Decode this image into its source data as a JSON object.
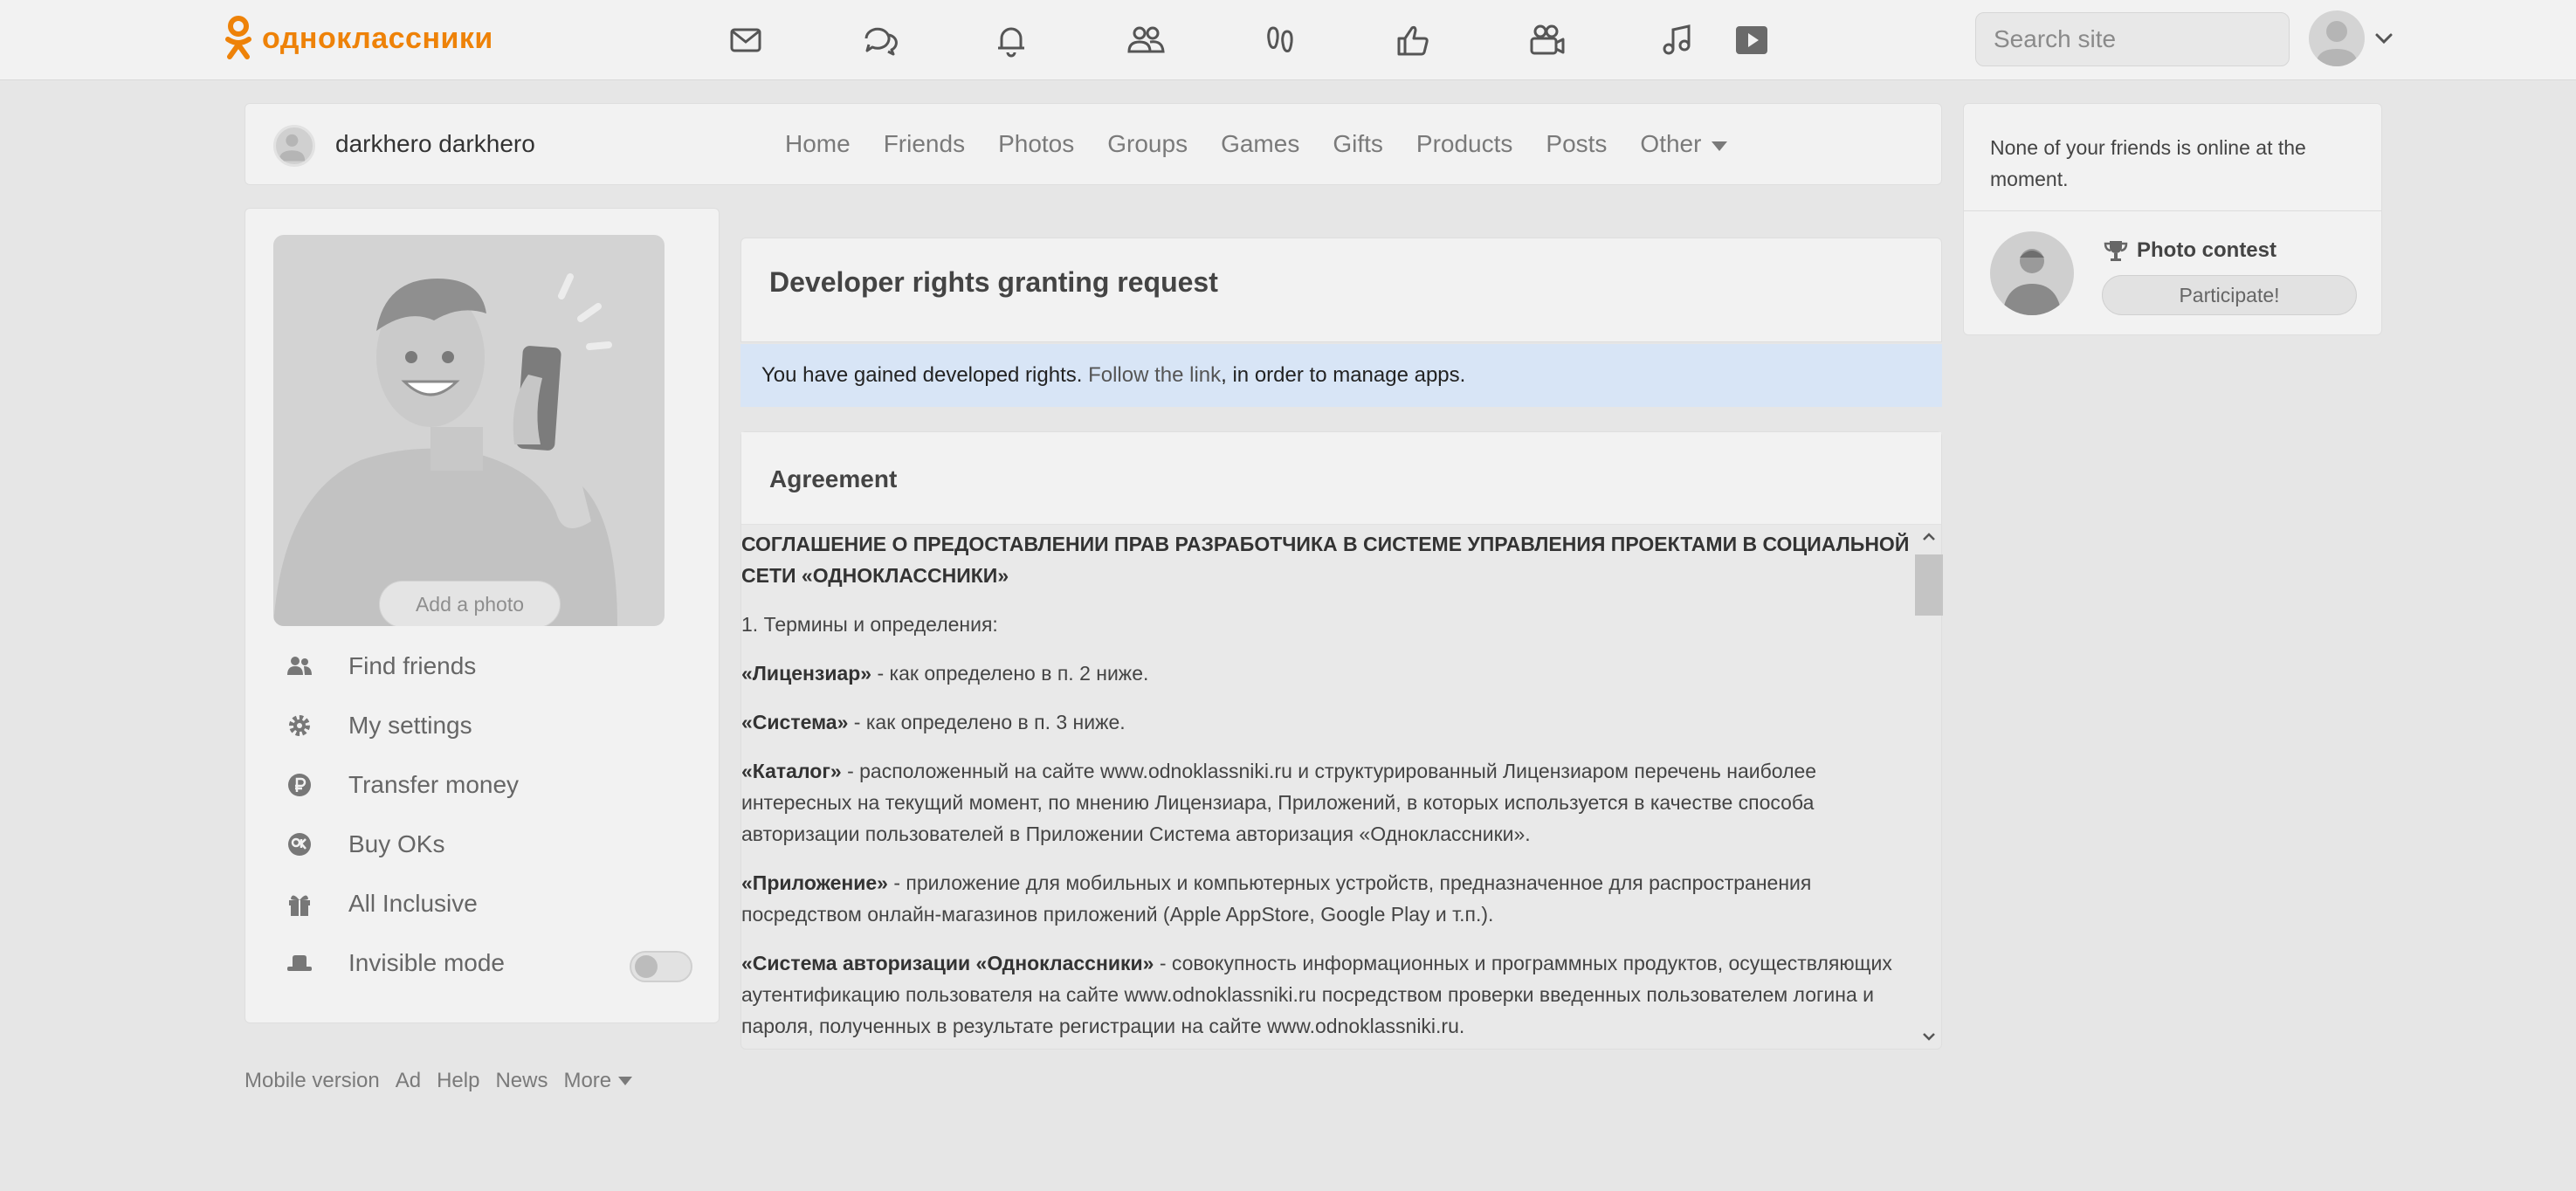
{
  "brand": {
    "name": "одноклассники",
    "color": "#ee8208"
  },
  "topnav": {
    "icons": [
      "envelope-icon",
      "chat-bubbles-icon",
      "bell-icon",
      "people-icon",
      "footprints-icon",
      "thumbs-up-icon",
      "camera-icon",
      "music-note-icon",
      "video-play-icon"
    ],
    "search_placeholder": "Search site"
  },
  "userbar": {
    "username": "darkhero darkhero",
    "nav": [
      "Home",
      "Friends",
      "Photos",
      "Groups",
      "Games",
      "Gifts",
      "Products",
      "Posts"
    ],
    "other_label": "Other"
  },
  "leftmenu": {
    "add_photo": "Add a photo",
    "items": [
      {
        "label": "Find friends",
        "icon": "people-icon"
      },
      {
        "label": "My settings",
        "icon": "gear-icon"
      },
      {
        "label": "Transfer money",
        "icon": "ruble-coin-icon"
      },
      {
        "label": "Buy OKs",
        "icon": "ok-coin-icon"
      },
      {
        "label": "All Inclusive",
        "icon": "gift-icon"
      },
      {
        "label": "Invisible mode",
        "icon": "hat-icon",
        "toggle": false
      }
    ]
  },
  "footer": {
    "links": [
      "Mobile version",
      "Ad",
      "Help",
      "News"
    ],
    "more": "More"
  },
  "main": {
    "title": "Developer rights granting request",
    "notice": {
      "before": "You have gained developed rights. ",
      "link": "Follow the link",
      "after": ", in order to manage apps."
    },
    "agreement": {
      "heading": "Agreement",
      "doc_title": "СОГЛАШЕНИЕ О ПРЕДОСТАВЛЕНИИ ПРАВ РАЗРАБОТЧИКА В СИСТЕМЕ УПРАВЛЕНИЯ ПРОЕКТАМИ В СОЦИАЛЬНОЙ СЕТИ «ОДНОКЛАССНИКИ»",
      "section1": "1. Термины и определения:",
      "defs": [
        {
          "term": "«Лицензиар»",
          "text": " - как определено в п. 2 ниже."
        },
        {
          "term": "«Система»",
          "text": " - как определено в п. 3 ниже."
        },
        {
          "term": "«Каталог»",
          "text": " - расположенный на сайте www.odnoklassniki.ru и структурированный Лицензиаром перечень наиболее интересных на текущий момент, по мнению Лицензиара, Приложений, в которых используется в качестве способа авторизации пользователей в Приложении Система авторизация «Одноклассники»."
        },
        {
          "term": "«Приложение»",
          "text": " - приложение для мобильных и компьютерных устройств, предназначенное для распространения посредством онлайн-магазинов приложений (Apple AppStore, Google Play и т.п.)."
        },
        {
          "term": "«Система авторизации «Одноклассники»",
          "text": " - совокупность информационных и программных продуктов, осуществляющих аутентификацию пользователя на сайте www.odnoklassniki.ru посредством проверки введенных пользователем логина и пароля, полученных в результате регистрации на сайте www.odnoklassniki.ru."
        }
      ]
    }
  },
  "right": {
    "online_text": "None of your friends is online at the moment.",
    "contest_title": "Photo contest",
    "participate": "Participate!"
  }
}
